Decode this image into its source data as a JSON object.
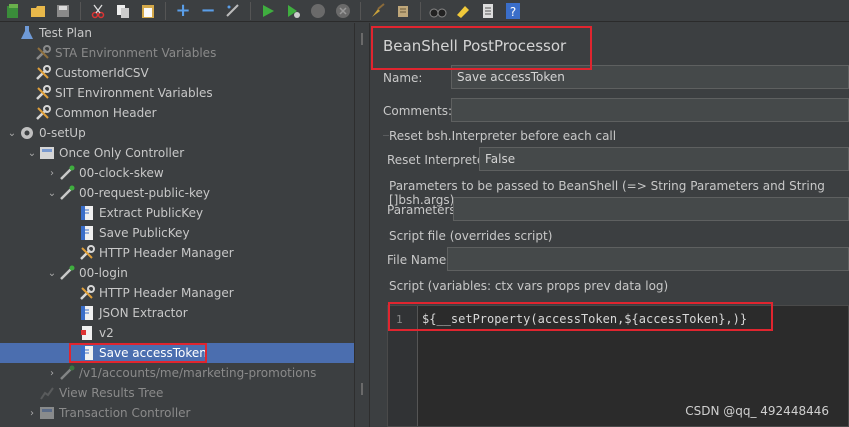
{
  "toolbar": {
    "buttons": [
      "new-icon",
      "templates-icon",
      "open-icon",
      "save-icon",
      "cut-icon",
      "copy-icon",
      "paste-icon",
      "expand-icon",
      "collapse-icon",
      "toggle-icon",
      "start-icon",
      "start-no-pause-icon",
      "stop-icon",
      "shutdown-icon",
      "clear-icon",
      "clear-all-icon",
      "search-icon",
      "reset-search-icon",
      "function-helper-icon",
      "help-icon"
    ]
  },
  "tree": {
    "items": [
      {
        "label": "Test Plan",
        "icon": "flask-icon"
      },
      {
        "label": "STA Environment Variables",
        "icon": "wrench-icon"
      },
      {
        "label": "CustomerIdCSV",
        "icon": "wrench-icon"
      },
      {
        "label": "SIT Environment Variables",
        "icon": "wrench-icon"
      },
      {
        "label": "Common Header",
        "icon": "wrench-icon"
      },
      {
        "label": "0-setUp",
        "icon": "gear-icon"
      },
      {
        "label": "Once Only Controller",
        "icon": "controller-icon"
      },
      {
        "label": "00-clock-skew",
        "icon": "sampler-icon"
      },
      {
        "label": "00-request-public-key",
        "icon": "sampler-icon"
      },
      {
        "label": "Extract PublicKey",
        "icon": "script-icon"
      },
      {
        "label": "Save PublicKey",
        "icon": "script-icon"
      },
      {
        "label": "HTTP Header Manager",
        "icon": "wrench-icon"
      },
      {
        "label": "00-login",
        "icon": "sampler-icon"
      },
      {
        "label": "HTTP Header Manager",
        "icon": "wrench-icon"
      },
      {
        "label": "JSON Extractor",
        "icon": "script-icon"
      },
      {
        "label": "v2",
        "icon": "assertion-icon"
      },
      {
        "label": "Save accessToken",
        "icon": "script-icon"
      },
      {
        "label": "/v1/accounts/me/marketing-promotions",
        "icon": "sampler-icon"
      },
      {
        "label": "View Results Tree",
        "icon": "chart-icon"
      },
      {
        "label": "Transaction Controller",
        "icon": "controller-icon"
      }
    ]
  },
  "panel": {
    "title": "BeanShell PostProcessor",
    "name_label": "Name:",
    "name_value": "Save accessToken",
    "comments_label": "Comments:",
    "comments_value": "",
    "reset_section": "Reset bsh.Interpreter before each call",
    "reset_label": "Reset Interpreter:",
    "reset_value": "False",
    "params_section": "Parameters to be passed to BeanShell (=> String Parameters and String []bsh.args)",
    "params_label": "Parameters:",
    "params_value": "",
    "file_section": "Script file (overrides script)",
    "file_label": "File Name:",
    "file_value": "",
    "script_section": "Script (variables: ctx vars props prev data log)",
    "line_number": "1",
    "script_code": "${__setProperty(accessToken,${accessToken},)}"
  },
  "watermark": "CSDN @qq_ 492448446",
  "colors": {
    "highlight": "#e0252f",
    "selection": "#4b6eaf",
    "background": "#3c3f41"
  }
}
